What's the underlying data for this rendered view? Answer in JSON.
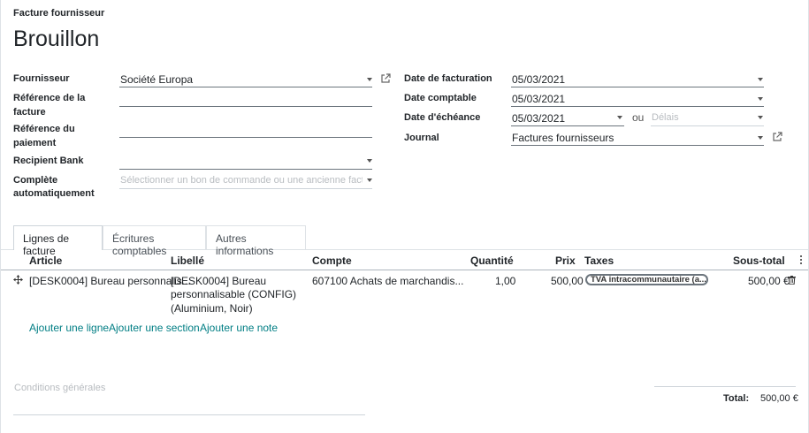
{
  "header": {
    "doc_type": "Facture fournisseur",
    "status": "Brouillon"
  },
  "left_fields": {
    "supplier_label": "Fournisseur",
    "supplier_value": "Société Europa",
    "invoice_ref_label_1": "Référence de la",
    "invoice_ref_label_2": "facture",
    "invoice_ref_value": "",
    "payment_ref_label_1": "Référence du",
    "payment_ref_label_2": "paiement",
    "payment_ref_value": "",
    "recipient_bank_label": "Recipient Bank",
    "recipient_bank_value": "",
    "autocomplete_label_1": "Complète",
    "autocomplete_label_2": "automatiquement",
    "autocomplete_placeholder": "Sélectionner un bon de commande ou une ancienne facture"
  },
  "right_fields": {
    "invoice_date_label": "Date de facturation",
    "invoice_date_value": "05/03/2021",
    "accounting_date_label": "Date comptable",
    "accounting_date_value": "05/03/2021",
    "due_date_label": "Date d'échéance",
    "due_date_value": "05/03/2021",
    "or_label": "ou",
    "terms_placeholder": "Délais",
    "journal_label": "Journal",
    "journal_value": "Factures fournisseurs"
  },
  "tabs": [
    {
      "label": "Lignes de facture",
      "active": true
    },
    {
      "label": "Écritures comptables",
      "active": false
    },
    {
      "label": "Autres informations",
      "active": false
    }
  ],
  "table": {
    "columns": {
      "article": "Article",
      "libelle": "Libellé",
      "compte": "Compte",
      "quantite": "Quantité",
      "prix": "Prix",
      "taxes": "Taxes",
      "sous_total": "Sous-total"
    },
    "rows": [
      {
        "article": "[DESK0004] Bureau personnalis...",
        "libelle_1": "[DESK0004] Bureau",
        "libelle_2": "personnalisable (CONFIG)",
        "libelle_3": "(Aluminium, Noir)",
        "compte": "607100 Achats de marchandis...",
        "quantite": "1,00",
        "prix": "500,00",
        "taxe": "TVA intracommunautaire (a...",
        "sous_total": "500,00 €"
      }
    ],
    "add_line": "Ajouter une ligne",
    "add_section": "Ajouter une section",
    "add_note": "Ajouter une note"
  },
  "footer": {
    "terms_placeholder": "Conditions générales",
    "total_label": "Total:",
    "total_value": "500,00 €"
  },
  "colors": {
    "link": "#017e84",
    "text": "#212529",
    "muted": "#b8bcc0"
  }
}
